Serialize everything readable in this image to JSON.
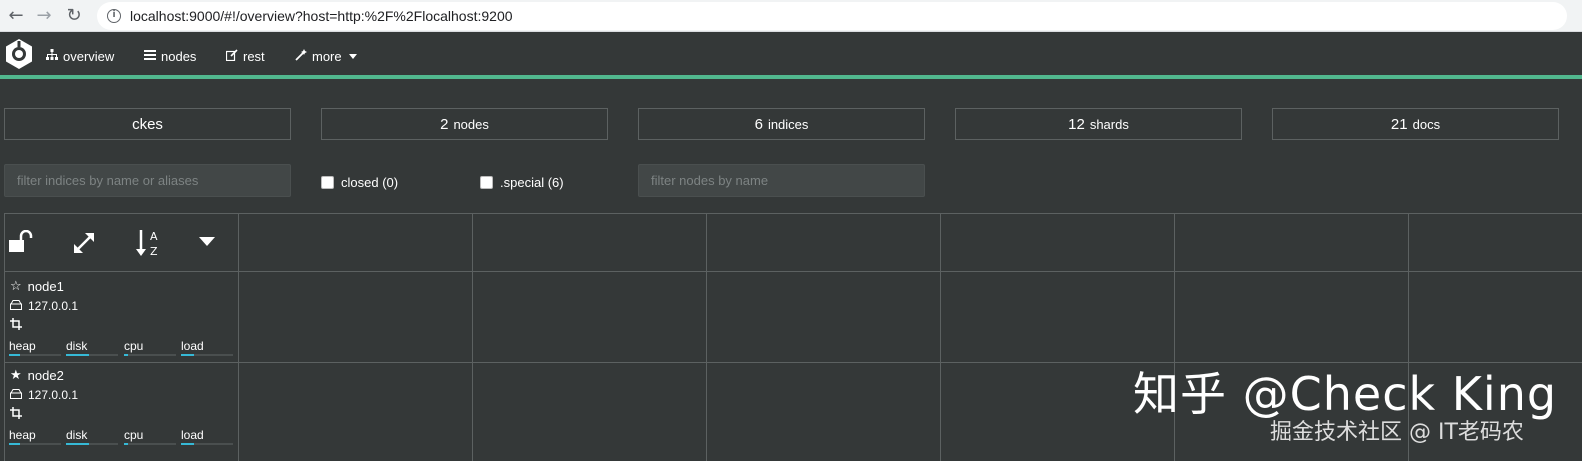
{
  "browser": {
    "back_icon": "←",
    "forward_icon": "→",
    "reload_icon": "↻",
    "info_icon": "i",
    "url": "localhost:9000/#!/overview?host=http:%2F%2Flocalhost:9200"
  },
  "navbar": {
    "items": [
      {
        "label": "overview",
        "icon": "sitemap-icon",
        "glyph": "⯎"
      },
      {
        "label": "nodes",
        "icon": "server-icon",
        "glyph": "▤"
      },
      {
        "label": "rest",
        "icon": "edit-icon",
        "glyph": "✎"
      },
      {
        "label": "more",
        "icon": "magic-wand-icon",
        "glyph": "⚲"
      }
    ],
    "accent_color": "#51b88e"
  },
  "summary": {
    "cluster_name": "ckes",
    "nodes": {
      "num": "2",
      "label": "nodes"
    },
    "indices": {
      "num": "6",
      "label": "indices"
    },
    "shards": {
      "num": "12",
      "label": "shards"
    },
    "docs": {
      "num": "21",
      "label": "docs"
    }
  },
  "filters": {
    "indices_placeholder": "filter indices by name or aliases",
    "closed_label": "closed (0)",
    "special_label": ".special (6)",
    "nodes_placeholder": "filter nodes by name"
  },
  "toolbar": {
    "lock_icon": "unlock-icon",
    "expand_icon": "expand-icon",
    "sort_icon": "sort-alpha-icon",
    "menu_icon": "caret-down-icon"
  },
  "nodes": [
    {
      "name": "node1",
      "star": "☆",
      "ip": "127.0.0.1",
      "metrics": [
        {
          "label": "heap",
          "fill": 0.22
        },
        {
          "label": "disk",
          "fill": 0.45
        },
        {
          "label": "cpu",
          "fill": 0.08
        },
        {
          "label": "load",
          "fill": 0.25
        }
      ]
    },
    {
      "name": "node2",
      "star": "★",
      "ip": "127.0.0.1",
      "metrics": [
        {
          "label": "heap",
          "fill": 0.22
        },
        {
          "label": "disk",
          "fill": 0.45
        },
        {
          "label": "cpu",
          "fill": 0.08
        },
        {
          "label": "load",
          "fill": 0.25
        }
      ]
    }
  ],
  "watermark": {
    "main": "知乎 @Check King",
    "sub": "掘金技术社区 @ IT老码农"
  }
}
